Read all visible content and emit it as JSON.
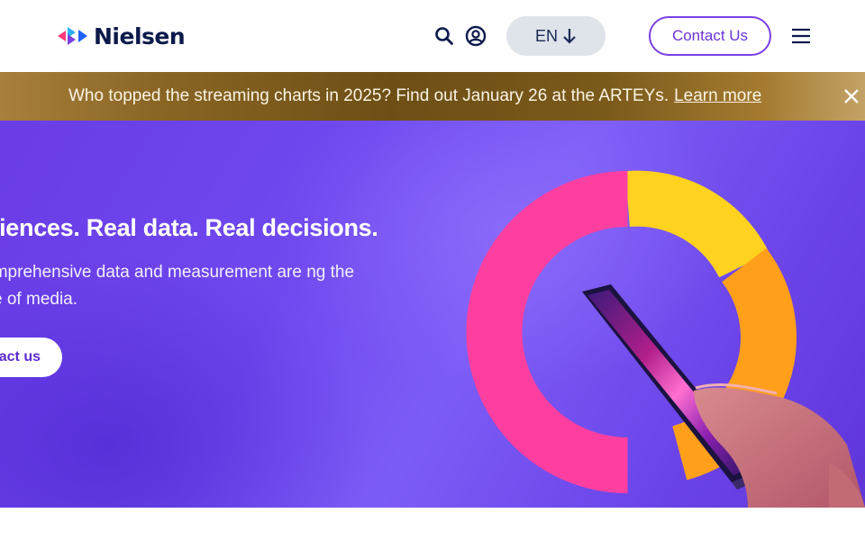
{
  "header": {
    "logo_text": "Nielsen",
    "language": "EN",
    "contact_label": "Contact Us"
  },
  "banner": {
    "message": "Who topped the streaming charts in 2025? Find out January 26 at the ARTEYs.",
    "link_label": "Learn more"
  },
  "hero": {
    "title": "audiences. Real data. Real decisions.",
    "subtitle": "’s comprehensive data and measurement are ng the future of media.",
    "cta_label": "act us"
  },
  "colors": {
    "brand_navy": "#0c1a4b",
    "accent_purple": "#7b3fe4",
    "hero_purple": "#6f49ef",
    "ring_pink": "#ff3fa0",
    "ring_yellow": "#ffd21f",
    "ring_orange": "#ff9f1a"
  },
  "icons": {
    "logo_mark": "nielsen-logo-mark-icon",
    "search": "search-icon",
    "account": "user-account-icon",
    "language_arrow": "arrow-down-icon",
    "menu": "hamburger-menu-icon",
    "close": "close-icon"
  }
}
